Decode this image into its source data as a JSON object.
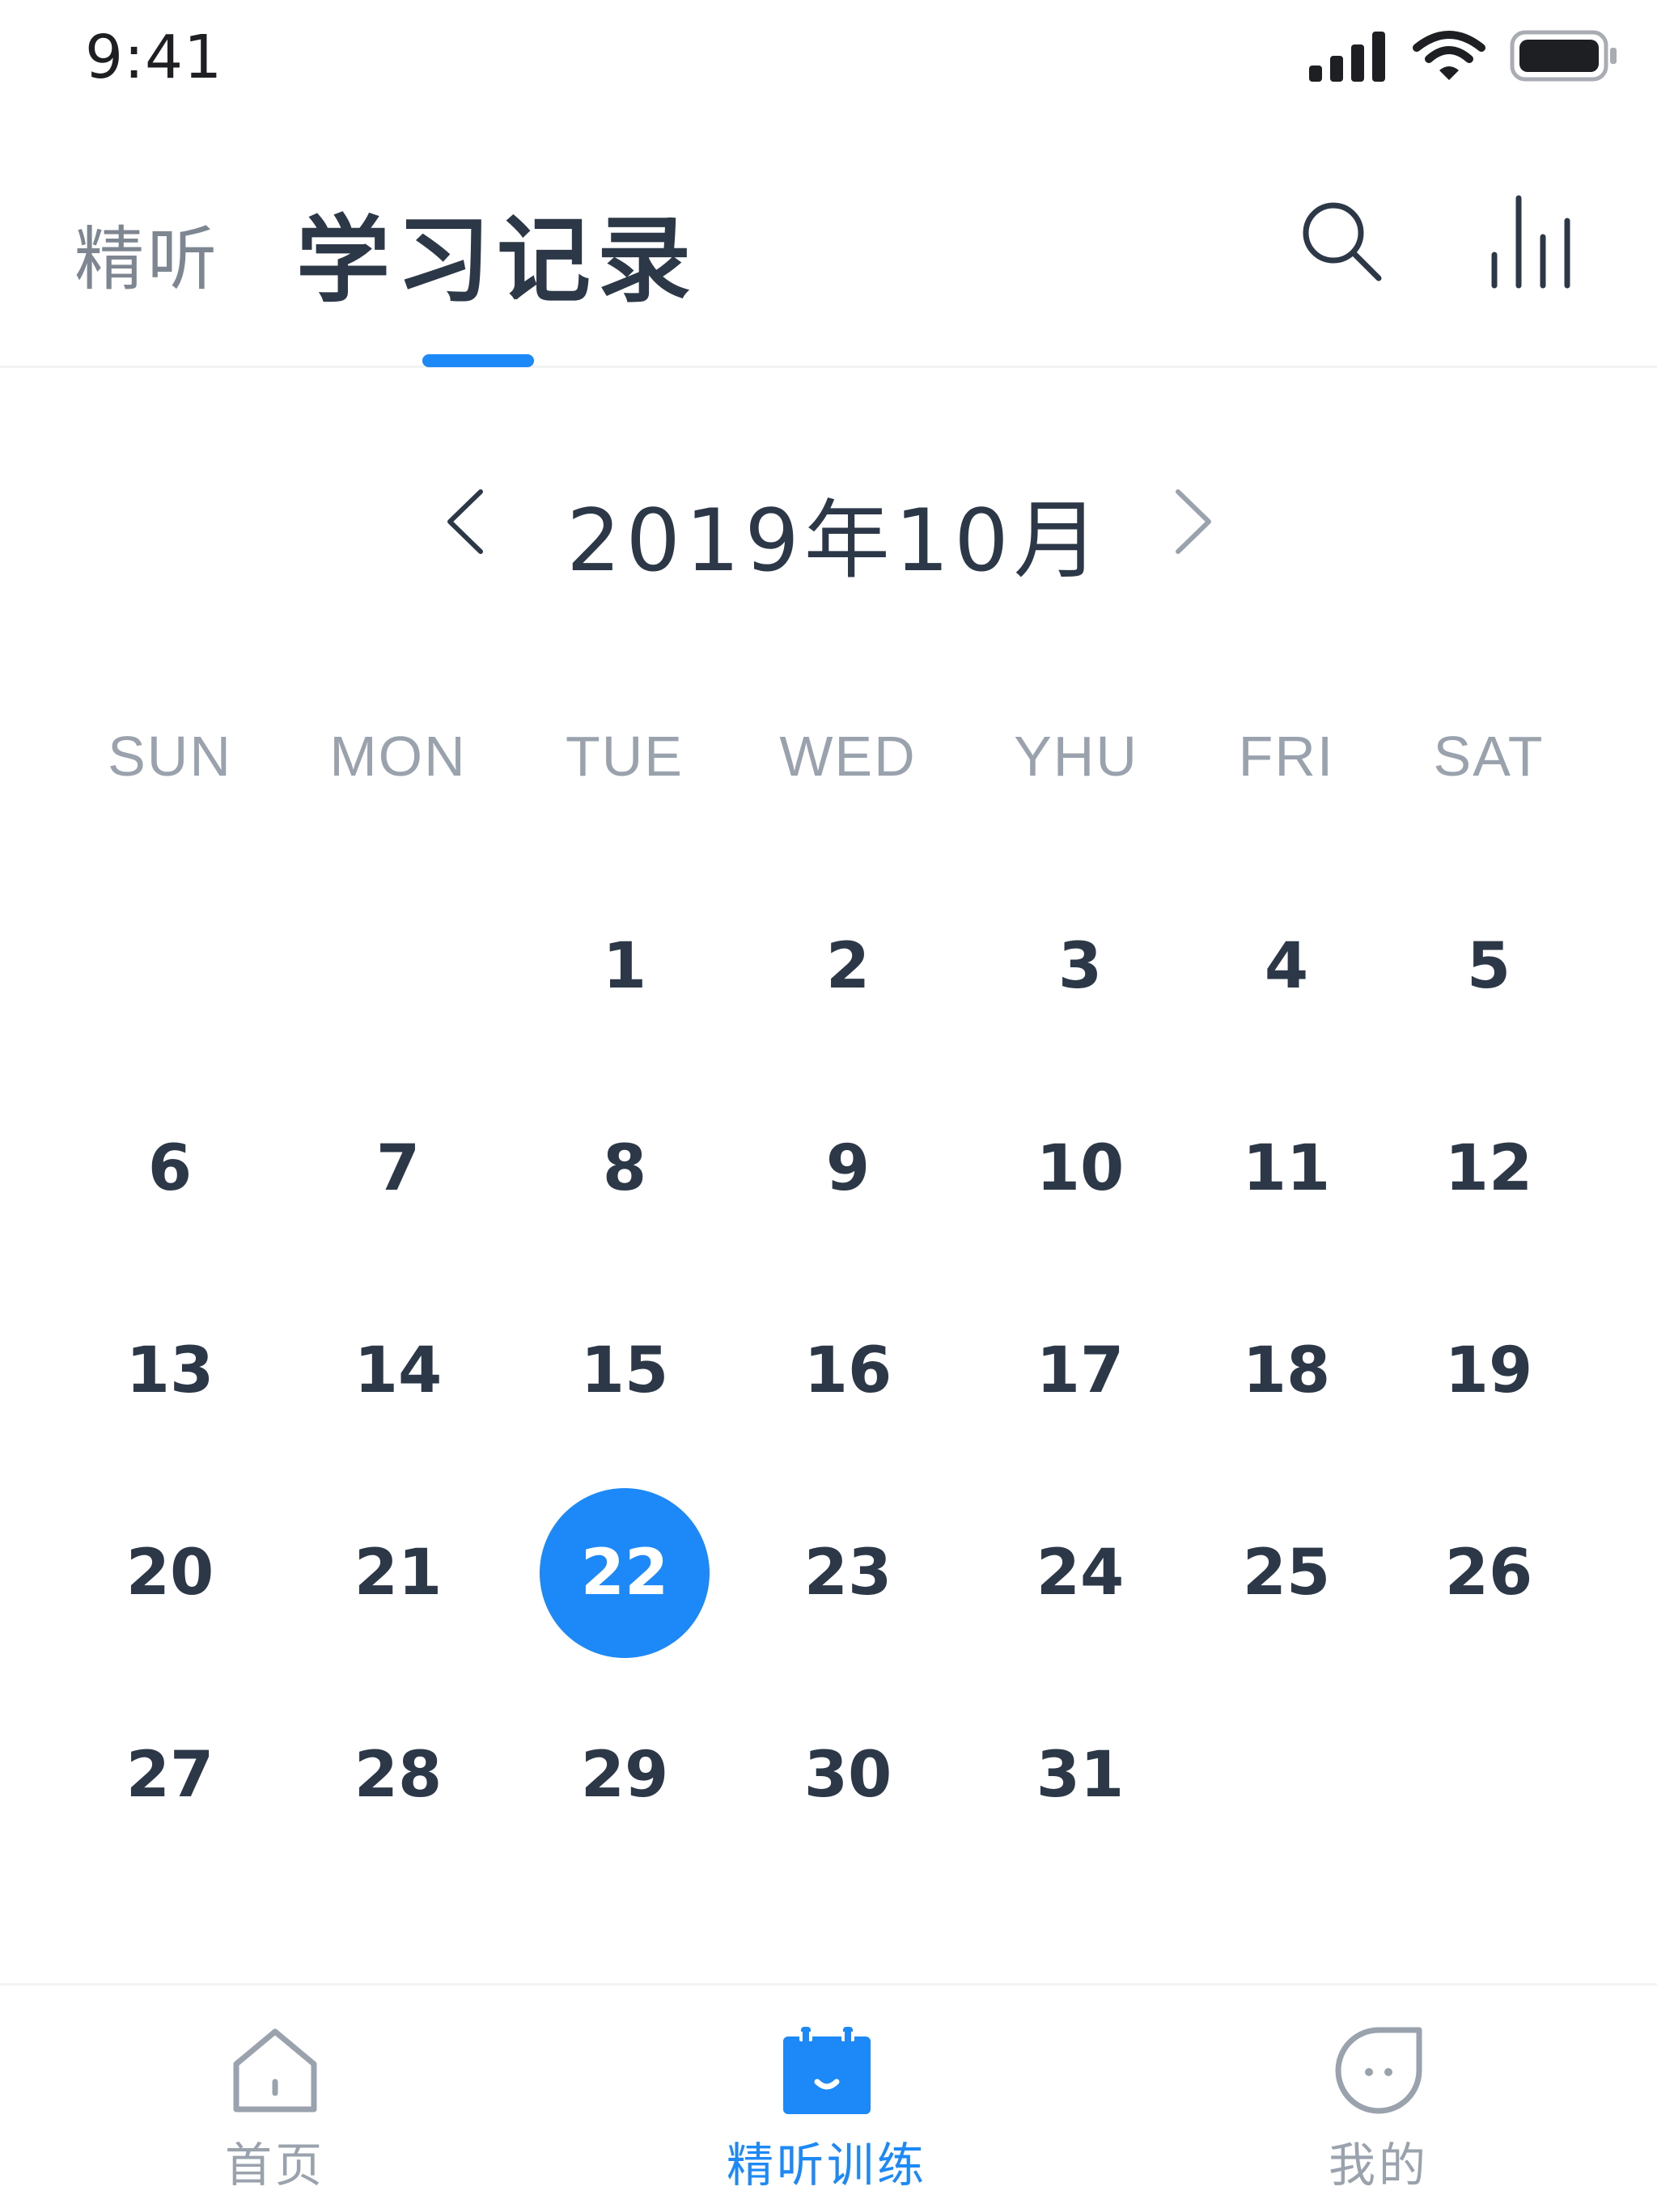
{
  "status_bar": {
    "time": "9:41",
    "icons": [
      "signal-icon",
      "wifi-icon",
      "battery-icon"
    ]
  },
  "header": {
    "tab_inactive": "精听",
    "tab_active": "学习记录",
    "actions": [
      "search-icon",
      "bar-chart-icon"
    ],
    "accent_color": "#1d88f7"
  },
  "calendar": {
    "month_title": "2019年10月",
    "prev_icon": "chevron-left-icon",
    "next_icon": "chevron-right-icon",
    "weekdays": [
      "SUN",
      "MON",
      "TUE",
      "WED",
      "YHU",
      "FRI",
      "SAT"
    ],
    "first_weekday_index": 2,
    "days_in_month": 31,
    "selected_day": 22,
    "days": [
      "1",
      "2",
      "3",
      "4",
      "5",
      "6",
      "7",
      "8",
      "9",
      "10",
      "11",
      "12",
      "13",
      "14",
      "15",
      "16",
      "17",
      "18",
      "19",
      "20",
      "21",
      "22",
      "23",
      "24",
      "25",
      "26",
      "27",
      "28",
      "29",
      "30",
      "31"
    ]
  },
  "bottom_nav": {
    "items": [
      {
        "label": "首页",
        "icon": "home-icon",
        "active": false
      },
      {
        "label": "精听训练",
        "icon": "calendar-smile-icon",
        "active": true
      },
      {
        "label": "我的",
        "icon": "chat-bubble-icon",
        "active": false
      }
    ]
  },
  "colors": {
    "primary_text": "#2c3847",
    "secondary_text": "#9aa3ad",
    "accent": "#1d88f7"
  }
}
